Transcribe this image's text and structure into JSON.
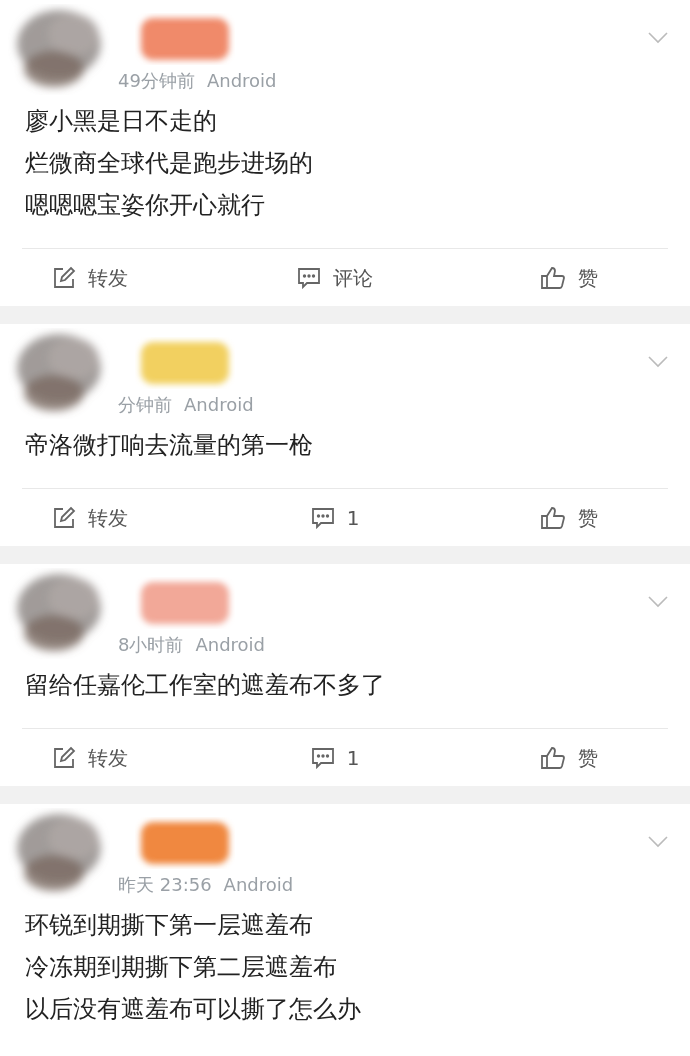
{
  "posts": [
    {
      "color": "#f08a6a",
      "time": "49分钟前",
      "source": "Android",
      "lines": [
        "廖小黑是日不走的",
        "烂微商全球代是跑步进场的",
        "嗯嗯嗯宝姿你开心就行"
      ],
      "actions": {
        "repost": "转发",
        "comment": "评论",
        "like": "赞"
      }
    },
    {
      "color": "#f2d060",
      "time": "分钟前",
      "source": "Android",
      "lines": [
        "帝洛微打响去流量的第一枪"
      ],
      "actions": {
        "repost": "转发",
        "comment": "1",
        "like": "赞"
      }
    },
    {
      "color": "#f2a898",
      "time": "8小时前",
      "source": "Android",
      "lines": [
        "留给任嘉伦工作室的遮羞布不多了"
      ],
      "actions": {
        "repost": "转发",
        "comment": "1",
        "like": "赞"
      }
    },
    {
      "color": "#f08840",
      "time": "昨天 23:56",
      "source": "Android",
      "lines": [
        "环锐到期撕下第一层遮羞布",
        "冷冻期到期撕下第二层遮羞布",
        "以后没有遮羞布可以撕了怎么办"
      ]
    }
  ]
}
